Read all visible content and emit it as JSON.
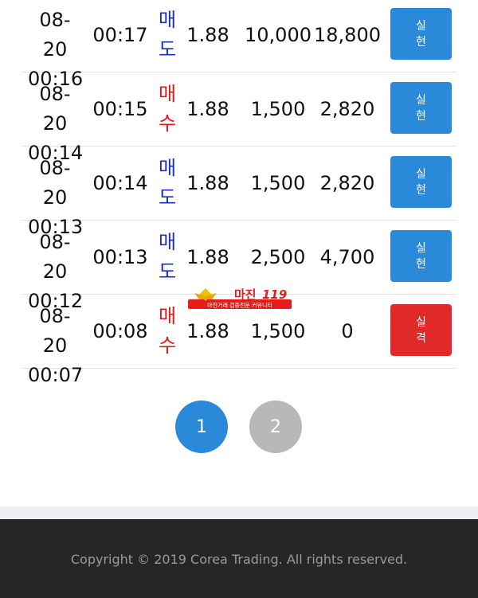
{
  "trades": [
    {
      "date": "08-20",
      "time": "00:16",
      "start": "00:17",
      "side_top": "매",
      "side_bottom": "도",
      "side_type": "sell",
      "leverage": "1.88",
      "qty": "10,000",
      "result": "18,800",
      "badge_top": "실",
      "badge_bottom": "현",
      "badge_type": "ok"
    },
    {
      "date": "08-20",
      "time": "00:14",
      "start": "00:15",
      "side_top": "매",
      "side_bottom": "수",
      "side_type": "buy",
      "leverage": "1.88",
      "qty": "1,500",
      "result": "2,820",
      "badge_top": "실",
      "badge_bottom": "현",
      "badge_type": "ok"
    },
    {
      "date": "08-20",
      "time": "00:13",
      "start": "00:14",
      "side_top": "매",
      "side_bottom": "도",
      "side_type": "sell",
      "leverage": "1.88",
      "qty": "1,500",
      "result": "2,820",
      "badge_top": "실",
      "badge_bottom": "현",
      "badge_type": "ok"
    },
    {
      "date": "08-20",
      "time": "00:12",
      "start": "00:13",
      "side_top": "매",
      "side_bottom": "도",
      "side_type": "sell",
      "leverage": "1.88",
      "qty": "2,500",
      "result": "4,700",
      "badge_top": "실",
      "badge_bottom": "현",
      "badge_type": "ok"
    },
    {
      "date": "08-20",
      "time": "00:07",
      "start": "00:08",
      "side_top": "매",
      "side_bottom": "수",
      "side_type": "buy",
      "leverage": "1.88",
      "qty": "1,500",
      "result": "0",
      "badge_top": "실",
      "badge_bottom": "격",
      "badge_type": "fail"
    }
  ],
  "pagination": {
    "pages": [
      "1",
      "2"
    ],
    "active": "1"
  },
  "watermark": {
    "title": "마진",
    "number": "119",
    "subtitle": "마진거래 검증전문 커뮤니티"
  },
  "footer": {
    "copyright": "Copyright © 2019 Corea Trading. All rights reserved."
  },
  "colors": {
    "accent": "#2a8ad9",
    "fail": "#e02a2a",
    "sell": "#1a2fc1",
    "buy": "#e21818",
    "footer_bg": "#262626"
  }
}
